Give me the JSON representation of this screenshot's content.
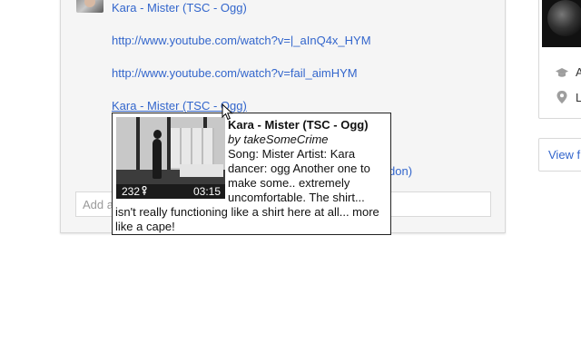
{
  "post": {
    "author_link": "Kara - Mister (TSC - Ogg)",
    "links": [
      "http://www.youtube.com/watch?v=|_aInQ4x_HYM",
      "http://www.youtube.com/watch?v=fail_aimHYM",
      "Kara - Mister (TSC - Ogg)"
    ],
    "partial_link_tail": "don)",
    "comment_placeholder": "Add a"
  },
  "tooltip": {
    "title": "Kara - Mister (TSC - Ogg)",
    "author": "by takeSomeCrime",
    "description_line1": "Song: Mister Artist: Kara dancer: ogg Another one to make some.. extremely uncomfortable. The shirt...",
    "description_line2": "isn't really functioning like a shirt here at all... more like a cape!",
    "views": "232",
    "duration": "03:15"
  },
  "right_panel": {
    "row1": "A",
    "row2": "L",
    "view_button": "View f"
  },
  "icons": {
    "education": "graduation-cap-icon",
    "location": "map-pin-icon",
    "views": "person-icon",
    "cursor": "mouse-cursor-icon"
  },
  "colors": {
    "link": "#3366cc",
    "card_bg": "#f5f5f5",
    "tooltip_border": "#222222"
  }
}
